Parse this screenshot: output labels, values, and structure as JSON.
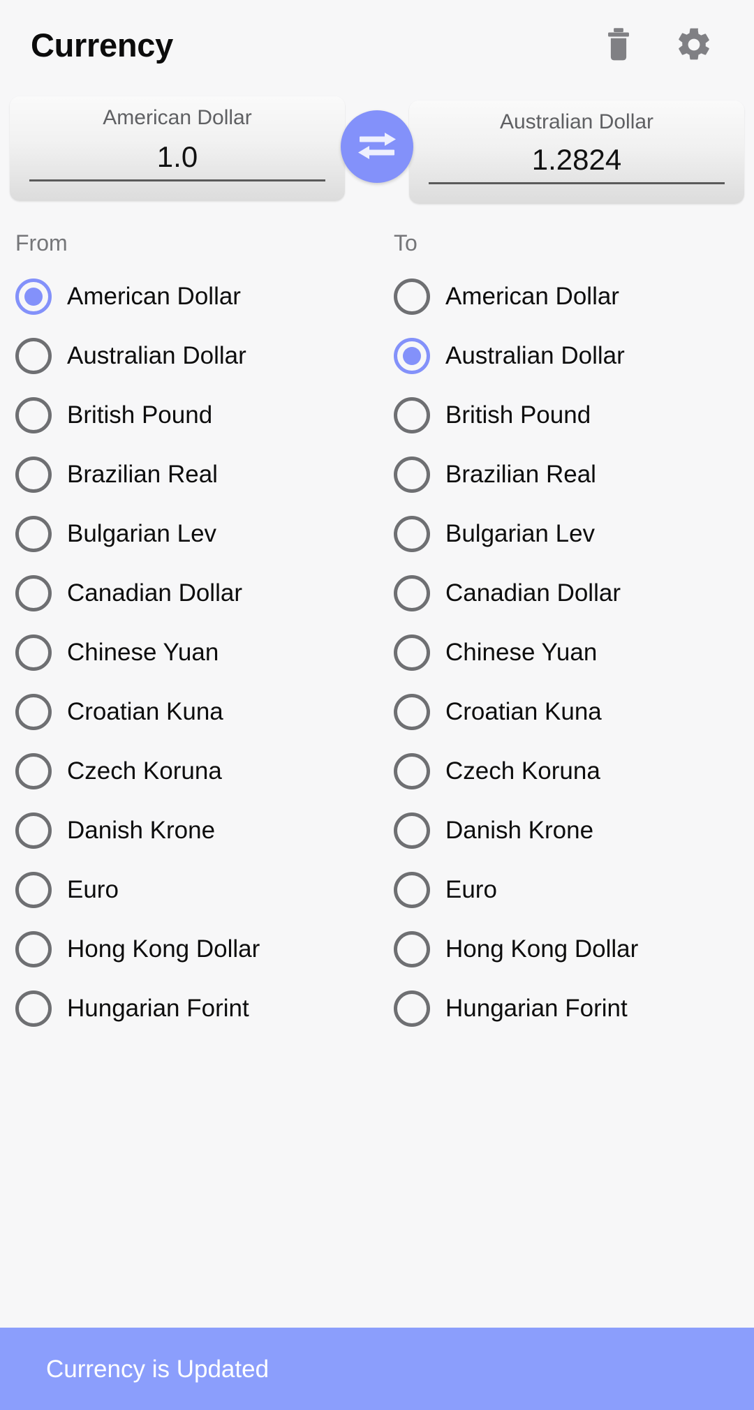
{
  "app": {
    "title": "Currency",
    "accent_color": "#8391fa",
    "snackbar_color": "#8b9efc",
    "background_color": "#f7f7f8"
  },
  "appbar": {
    "actions": [
      {
        "name": "delete-icon",
        "label": "Delete"
      },
      {
        "name": "settings-icon",
        "label": "Settings"
      }
    ]
  },
  "converter": {
    "swap_button_label": "Swap currencies",
    "from": {
      "currency": "American Dollar",
      "value": "1.0"
    },
    "to": {
      "currency": "Australian Dollar",
      "value": "1.2824"
    }
  },
  "lists": {
    "from": {
      "header": "From",
      "selected": "American Dollar",
      "items": [
        {
          "label": "American Dollar",
          "selected": true
        },
        {
          "label": "Australian Dollar",
          "selected": false
        },
        {
          "label": "British Pound",
          "selected": false
        },
        {
          "label": "Brazilian Real",
          "selected": false
        },
        {
          "label": "Bulgarian Lev",
          "selected": false
        },
        {
          "label": "Canadian Dollar",
          "selected": false
        },
        {
          "label": "Chinese Yuan",
          "selected": false
        },
        {
          "label": "Croatian Kuna",
          "selected": false
        },
        {
          "label": "Czech Koruna",
          "selected": false
        },
        {
          "label": "Danish Krone",
          "selected": false
        },
        {
          "label": "Euro",
          "selected": false
        },
        {
          "label": "Hong Kong Dollar",
          "selected": false
        },
        {
          "label": "Hungarian Forint",
          "selected": false
        }
      ]
    },
    "to": {
      "header": "To",
      "selected": "Australian Dollar",
      "items": [
        {
          "label": "American Dollar",
          "selected": false
        },
        {
          "label": "Australian Dollar",
          "selected": true
        },
        {
          "label": "British Pound",
          "selected": false
        },
        {
          "label": "Brazilian Real",
          "selected": false
        },
        {
          "label": "Bulgarian Lev",
          "selected": false
        },
        {
          "label": "Canadian Dollar",
          "selected": false
        },
        {
          "label": "Chinese Yuan",
          "selected": false
        },
        {
          "label": "Croatian Kuna",
          "selected": false
        },
        {
          "label": "Czech Koruna",
          "selected": false
        },
        {
          "label": "Danish Krone",
          "selected": false
        },
        {
          "label": "Euro",
          "selected": false
        },
        {
          "label": "Hong Kong Dollar",
          "selected": false
        },
        {
          "label": "Hungarian Forint",
          "selected": false
        }
      ]
    }
  },
  "snackbar": {
    "message": "Currency is Updated"
  }
}
